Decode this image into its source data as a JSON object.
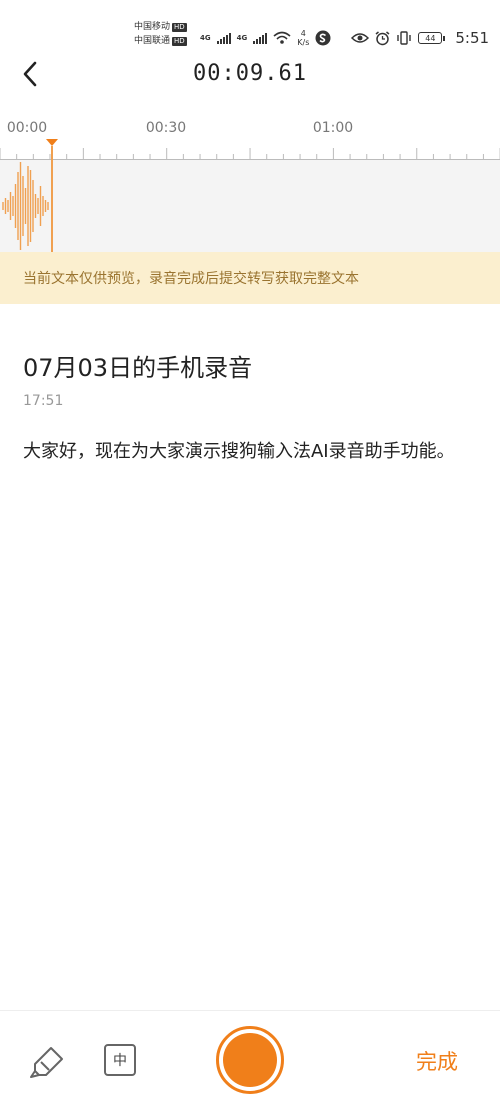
{
  "status_bar": {
    "carrier1": "中国移动",
    "carrier2": "中国联通",
    "hd": "HD",
    "net_type": "4G",
    "net_speed_value": "4",
    "net_speed_unit": "K/s",
    "battery": "44",
    "time": "5:51"
  },
  "header": {
    "timer": "00:09.61"
  },
  "timeline": {
    "labels": [
      "00:00",
      "00:30",
      "01:00"
    ],
    "accent_color": "#f07f1a"
  },
  "notice": {
    "text": "当前文本仅供预览，录音完成后提交转写获取完整文本"
  },
  "recording": {
    "title": "07月03日的手机录音",
    "time": "17:51",
    "transcript": "大家好，现在为大家演示搜狗输入法AI录音助手功能。"
  },
  "bottom_bar": {
    "ime_label": "中",
    "done_label": "完成",
    "marker_icon": "highlighter-icon",
    "record_icon": "record-icon"
  }
}
